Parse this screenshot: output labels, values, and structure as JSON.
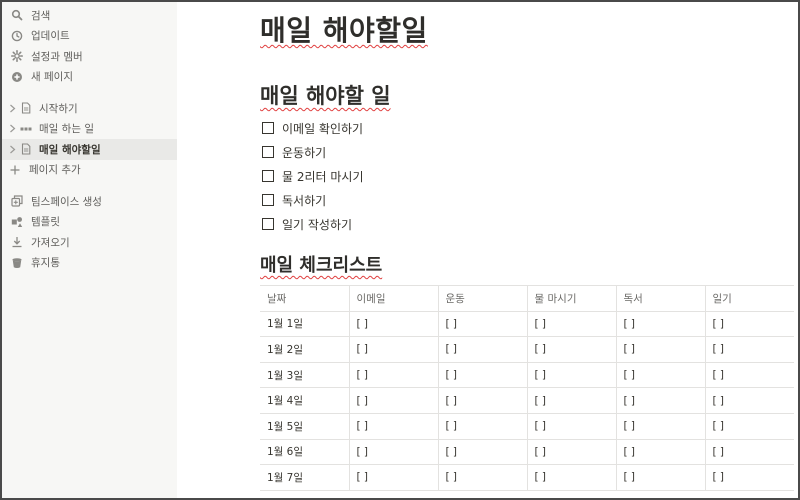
{
  "sidebar": {
    "top_items": [
      {
        "label": "검색",
        "icon": "search-icon"
      },
      {
        "label": "업데이트",
        "icon": "clock-icon"
      },
      {
        "label": "설정과 멤버",
        "icon": "gear-icon"
      },
      {
        "label": "새 페이지",
        "icon": "plus-circle-icon"
      }
    ],
    "pages": [
      {
        "label": "시작하기",
        "icon": "page-icon"
      },
      {
        "label": "매일 하는 일",
        "icon": "database-icon"
      },
      {
        "label": "매일 해야할일",
        "icon": "page-icon",
        "active": true
      }
    ],
    "add_page_label": "페이지 추가",
    "bottom_items": [
      {
        "label": "팀스페이스 생성",
        "icon": "teamspace-icon"
      },
      {
        "label": "템플릿",
        "icon": "template-icon"
      },
      {
        "label": "가져오기",
        "icon": "import-icon"
      },
      {
        "label": "휴지통",
        "icon": "trash-icon"
      }
    ]
  },
  "page": {
    "title": "매일 해야할일",
    "heading_todo": "매일 해야할 일",
    "todos": [
      {
        "label": "이메일 확인하기",
        "checked": false
      },
      {
        "label": "운동하기",
        "checked": false
      },
      {
        "label": "물 2리터 마시기",
        "checked": false
      },
      {
        "label": "독서하기",
        "checked": false
      },
      {
        "label": "일기 작성하기",
        "checked": false
      }
    ],
    "heading_checklist": "매일 체크리스트",
    "table": {
      "headers": [
        "날짜",
        "이메일",
        "운동",
        "물 마시기",
        "독서",
        "일기"
      ],
      "rows": [
        [
          "1월 1일",
          "[ ]",
          "[ ]",
          "[ ]",
          "[ ]",
          "[ ]"
        ],
        [
          "1월 2일",
          "[ ]",
          "[ ]",
          "[ ]",
          "[ ]",
          "[ ]"
        ],
        [
          "1월 3일",
          "[ ]",
          "[ ]",
          "[ ]",
          "[ ]",
          "[ ]"
        ],
        [
          "1월 4일",
          "[ ]",
          "[ ]",
          "[ ]",
          "[ ]",
          "[ ]"
        ],
        [
          "1월 5일",
          "[ ]",
          "[ ]",
          "[ ]",
          "[ ]",
          "[ ]"
        ],
        [
          "1월 6일",
          "[ ]",
          "[ ]",
          "[ ]",
          "[ ]",
          "[ ]"
        ],
        [
          "1월 7일",
          "[ ]",
          "[ ]",
          "[ ]",
          "[ ]",
          "[ ]"
        ]
      ]
    }
  },
  "colors": {
    "sidebar_bg": "#f7f7f5",
    "text": "#37352f",
    "active_bg": "#e9e9e7",
    "spellcheck": "#e03e3e"
  }
}
